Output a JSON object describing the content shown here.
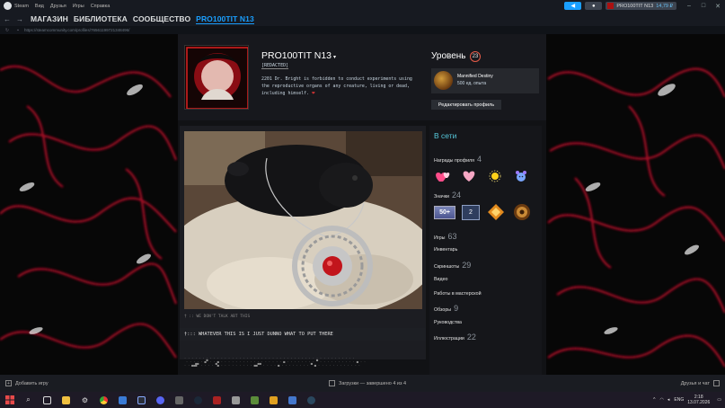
{
  "titlebar": {
    "menu": [
      "Steam",
      "Вид",
      "Друзья",
      "Игры",
      "Справка"
    ],
    "user_name": "PRO100TIT N13",
    "wallet": "14,79 ₽"
  },
  "nav": {
    "tabs": [
      "МАГАЗИН",
      "БИБЛИОТЕКА",
      "СООБЩЕСТВО",
      "PRO100TIT N13"
    ],
    "active_tab": "PRO100TIT N13"
  },
  "urlbar": {
    "url": "https://steamcommunity.com/profiles/76561199721348496/"
  },
  "profile": {
    "persona_name": "PRO100TIT N13",
    "real_name": "[REDACTED]",
    "summary_line1": "2201 Dr. Bright is forbidden to conduct experiments using",
    "summary_line2": "the reproductive organs of any creature, living or dead,",
    "summary_line3": "including himself.",
    "level_label": "Уровень",
    "level": "23",
    "badge_name": "Mannified Destiny",
    "badge_xp": "500 ед. опыта",
    "edit_button": "Редактировать профиль"
  },
  "showcase": {
    "caption": "† :: WE DON'T TALK ABT THIS",
    "section_title": "†::: WHATEVER THIS IS I JUST DUNNO WHAT TO PUT THERE",
    "ascii_art": ". . . . . . . . . . . . . . . . . . . . . . . . . . . . . . . . . . . . . . . . . . . . . . .\n . . . . . ▄▀ . . ▄ . . . . . . . . . . . . . . . . . ▄ . . . . . . . . ▀ . . . . . . . . . . ▄ . .\n. . ▄▄█▀ . . . . ▀▄ . . . . . . . . . ▄▄▀▀ . . . . ▄ . . . . . . . . ▀ ▄ . . . . . . . . . . . ."
  },
  "sidebar": {
    "status": "В сети",
    "awards_label": "Награды профиля",
    "awards_count": "4",
    "badges_label": "Значки",
    "badges_count": "24",
    "badge_50": "50+",
    "badge_2": "2",
    "games_label": "Игры",
    "games_count": "63",
    "inventory_label": "Инвентарь",
    "screenshots_label": "Скриншоты",
    "screenshots_count": "29",
    "videos_label": "Видео",
    "workshop_label": "Работы в мастерской",
    "reviews_label": "Обзоры",
    "reviews_count": "9",
    "guides_label": "Руководства",
    "artwork_label": "Иллюстрации",
    "artwork_count": "22"
  },
  "bottombar": {
    "add_game": "Добавить игру",
    "downloads": "Загрузки — завершено 4 из 4",
    "friends_chat": "Друзья и чат"
  },
  "taskbar": {
    "lang": "ENG",
    "time": "2:18",
    "date": "13.07.2026"
  },
  "colors": {
    "accent_blue": "#1a9fff",
    "online_cyan": "#57cbde",
    "level_ring": "#e65b48",
    "bg_red": "#c0102a"
  }
}
